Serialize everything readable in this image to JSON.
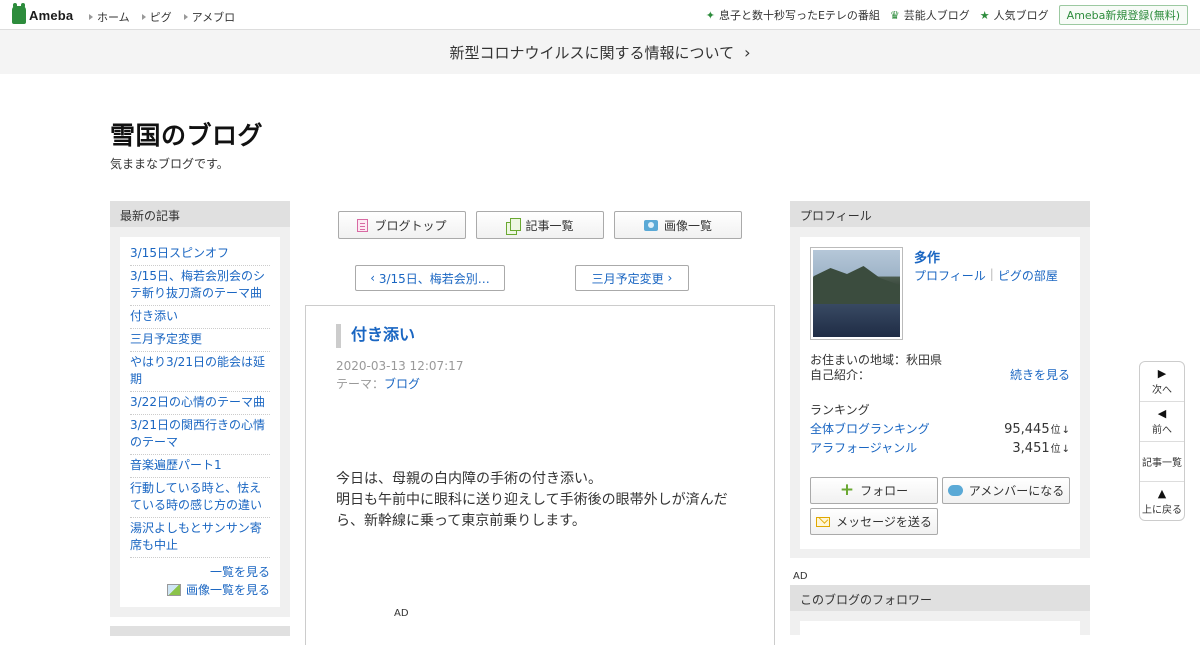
{
  "topbar": {
    "logo": "Ameba",
    "nav": [
      "ホーム",
      "ピグ",
      "アメブロ"
    ],
    "right_links": [
      {
        "icon": "star-icon",
        "label": "息子と数十秒写ったEテレの番組"
      },
      {
        "icon": "crown-icon",
        "label": "芸能人ブログ"
      },
      {
        "icon": "star-icon",
        "label": "人気ブログ"
      }
    ],
    "signup": "Ameba新規登録(無料)"
  },
  "notice": {
    "text": "新型コロナウイルスに関する情報について"
  },
  "blog": {
    "title": "雪国のブログ",
    "description": "気ままなブログです。"
  },
  "sidebar_left": {
    "heading": "最新の記事",
    "items": [
      "3/15日スピンオフ",
      "3/15日、梅若会別会のシテ斬り抜刀斎のテーマ曲",
      "付き添い",
      "三月予定変更",
      "やはり3/21日の能会は延期",
      "3/22日の心情のテーマ曲",
      "3/21日の関西行きの心情のテーマ",
      "音楽遍歴パート1",
      "行動している時と、怯えている時の感じ方の違い",
      "湯沢よしもとサンサン寄席も中止"
    ],
    "more": "一覧を見る",
    "more_images": "画像一覧を見る"
  },
  "tabs": {
    "top": "ブログトップ",
    "list": "記事一覧",
    "images": "画像一覧"
  },
  "pager": {
    "prev": "3/15日、梅若会別…",
    "next": "三月予定変更"
  },
  "article": {
    "title": "付き添い",
    "date": "2020-03-13 12:07:17",
    "theme_label": "テーマ：",
    "theme": "ブログ",
    "body_lines": [
      "今日は、母親の白内障の手術の付き添い。",
      "明日も午前中に眼科に送り迎えして手術後の眼帯外しが済んだら、新幹線に乗って東京前乗りします。"
    ],
    "ad": "AD"
  },
  "profile": {
    "heading": "プロフィール",
    "name": "多作",
    "link_profile": "プロフィール",
    "link_room": "ピグの部屋",
    "location": "お住まいの地域：秋田県",
    "intro": "自己紹介：",
    "read_more": "続きを見る",
    "ranking_head": "ランキング",
    "rankings": [
      {
        "name": "全体ブログランキング",
        "value": "95,445",
        "unit": "位",
        "trend": "↓"
      },
      {
        "name": "アラフォージャンル",
        "value": "3,451",
        "unit": "位",
        "trend": "↓"
      }
    ],
    "follow": "フォロー",
    "member": "アメンバーになる",
    "message": "メッセージを送る"
  },
  "right_ad": "AD",
  "followers": {
    "heading": "このブログのフォロワー"
  },
  "floatnav": {
    "next": "次へ",
    "prev": "前へ",
    "list": "記事一覧",
    "top": "上に戻る"
  }
}
